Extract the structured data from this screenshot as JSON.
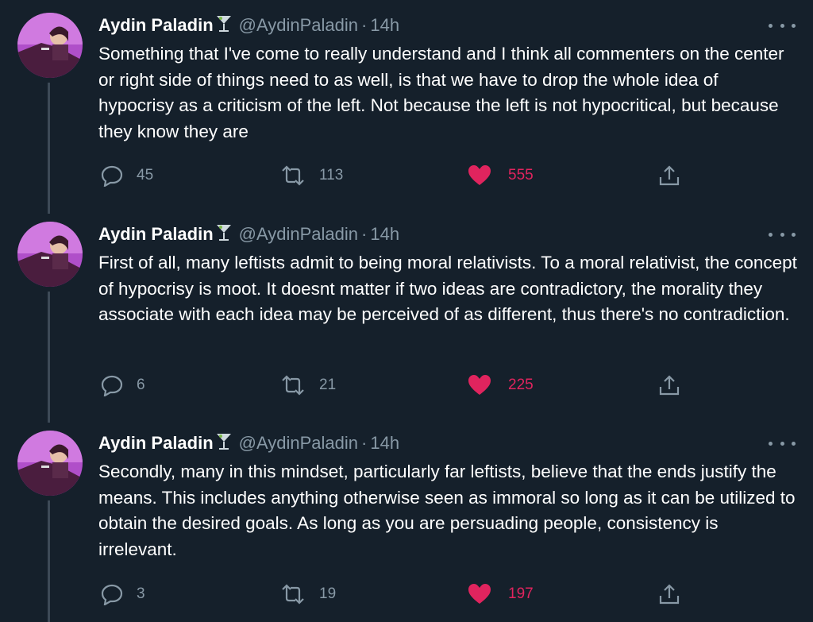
{
  "tweets": [
    {
      "author_name": "Aydin Paladin",
      "author_handle": "@AydinPaladin",
      "separator": "·",
      "time": "14h",
      "text": "Something that I've come to really understand and I think all commenters on the center or right side of things need to as well, is that we have to drop the whole idea of hypocrisy as a criticism of the left. Not because the left is not hypocritical, but because they know they are",
      "replies": "45",
      "retweets": "113",
      "likes": "555"
    },
    {
      "author_name": "Aydin Paladin",
      "author_handle": "@AydinPaladin",
      "separator": "·",
      "time": "14h",
      "text": "First of all, many leftists admit to being moral relativists. To a moral relativist, the concept of hypocrisy is moot. It doesnt matter if two ideas are contradictory, the morality they associate with each idea may be perceived of as different, thus there's no contradiction.",
      "replies": "6",
      "retweets": "21",
      "likes": "225"
    },
    {
      "author_name": "Aydin Paladin",
      "author_handle": "@AydinPaladin",
      "separator": "·",
      "time": "14h",
      "text": "Secondly, many in this mindset, particularly far leftists, believe that the ends justify the means. This includes anything otherwise seen as immoral so long as it can be utilized to obtain the desired goals. As long as you are persuading people, consistency is irrelevant.",
      "replies": "3",
      "retweets": "19",
      "likes": "197"
    }
  ],
  "icons": {
    "name_emoji": "cocktail-glass-icon",
    "reply": "reply-icon",
    "retweet": "retweet-icon",
    "like": "heart-icon",
    "share": "share-icon",
    "more": "more-icon"
  },
  "colors": {
    "background": "#15202b",
    "text": "#ffffff",
    "secondary": "#8899a6",
    "like_active": "#e0245e",
    "thread_line": "#3d4a57"
  }
}
